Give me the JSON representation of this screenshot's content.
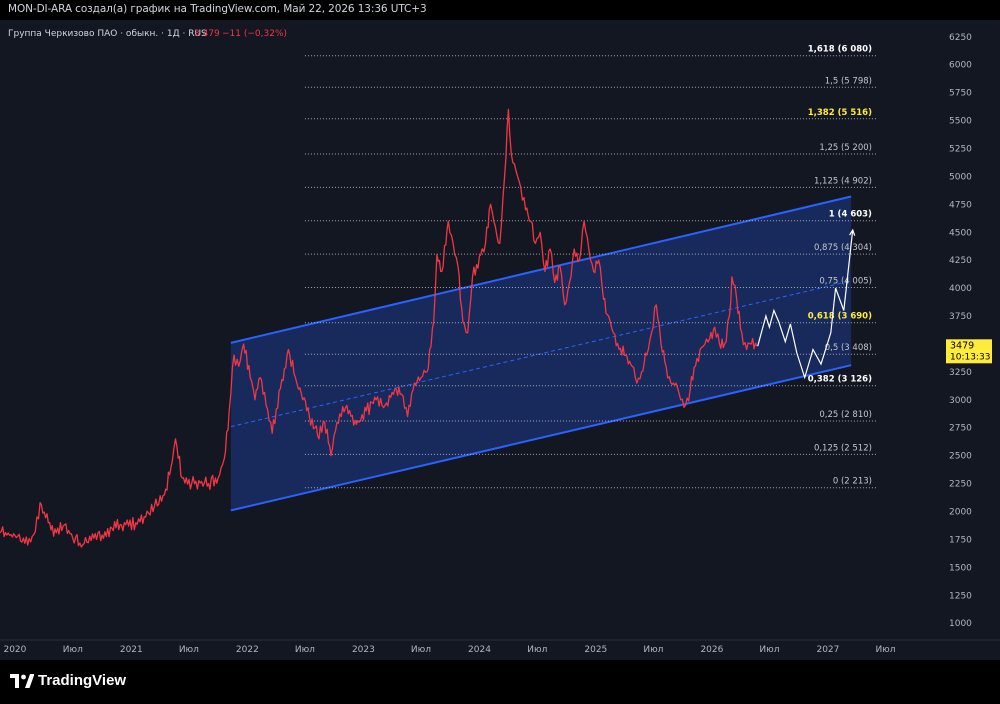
{
  "header": {
    "publish_line": "MON-DI-ARA создал(а) график на TradingView.com, Май 22, 2026 13:36 UTC+3"
  },
  "legend": {
    "symbol_line": "Группа Черкизово ПАО · обыкн. · 1Д · RUS",
    "price": "3 479",
    "change": "−11 (−0,32%)"
  },
  "price_tag": {
    "price": "3479",
    "countdown": "10:13:33"
  },
  "branding": {
    "logo_text": "TradingView"
  },
  "colors": {
    "background": "#131722",
    "panel": "#000000",
    "price_line": "#f23645",
    "channel": "#2962ff",
    "channel_fill": "#1e3a8a",
    "fib_line": "#9598a1",
    "highlight_level": "#ffeb3b",
    "projection": "#ffffff",
    "text": "#d1d4dc"
  },
  "chart_data": {
    "type": "line",
    "title": "Группа Черкизово ПАО · обыкн. · 1Д · RUS",
    "ylim": [
      850,
      6400
    ],
    "y_ticks": [
      1000,
      1250,
      1500,
      1750,
      2000,
      2250,
      2500,
      2750,
      3000,
      3250,
      3500,
      3750,
      4000,
      4250,
      4500,
      4750,
      5000,
      5250,
      5500,
      5750,
      6000,
      6250
    ],
    "xlim": [
      "2019-11-15",
      "2028-01-01"
    ],
    "x_ticks": [
      {
        "label": "2020",
        "date": "2020-01-01"
      },
      {
        "label": "Июл",
        "date": "2020-07-01"
      },
      {
        "label": "2021",
        "date": "2021-01-01"
      },
      {
        "label": "Июл",
        "date": "2021-07-01"
      },
      {
        "label": "2022",
        "date": "2022-01-01"
      },
      {
        "label": "Июл",
        "date": "2022-07-01"
      },
      {
        "label": "2023",
        "date": "2023-01-01"
      },
      {
        "label": "Июл",
        "date": "2023-07-01"
      },
      {
        "label": "2024",
        "date": "2024-01-01"
      },
      {
        "label": "Июл",
        "date": "2024-07-01"
      },
      {
        "label": "2025",
        "date": "2025-01-01"
      },
      {
        "label": "Июл",
        "date": "2025-07-01"
      },
      {
        "label": "2026",
        "date": "2026-01-01"
      },
      {
        "label": "Июл",
        "date": "2026-07-01"
      },
      {
        "label": "2027",
        "date": "2027-01-01"
      },
      {
        "label": "Июл",
        "date": "2027-07-01"
      }
    ],
    "grid": false,
    "series": [
      {
        "type": "line",
        "color": "#f23645",
        "points": [
          [
            "2019-11-15",
            1810
          ],
          [
            "2020-01-10",
            1780
          ],
          [
            "2020-02-10",
            1700
          ],
          [
            "2020-03-05",
            1820
          ],
          [
            "2020-03-20",
            2080
          ],
          [
            "2020-04-15",
            1900
          ],
          [
            "2020-05-10",
            1810
          ],
          [
            "2020-06-05",
            1880
          ],
          [
            "2020-07-01",
            1760
          ],
          [
            "2020-08-01",
            1700
          ],
          [
            "2020-09-01",
            1800
          ],
          [
            "2020-10-01",
            1790
          ],
          [
            "2020-11-01",
            1850
          ],
          [
            "2020-12-01",
            1880
          ],
          [
            "2021-01-15",
            1900
          ],
          [
            "2021-02-15",
            1950
          ],
          [
            "2021-03-15",
            2050
          ],
          [
            "2021-04-15",
            2150
          ],
          [
            "2021-05-10",
            2450
          ],
          [
            "2021-05-20",
            2650
          ],
          [
            "2021-06-10",
            2300
          ],
          [
            "2021-07-10",
            2250
          ],
          [
            "2021-08-10",
            2270
          ],
          [
            "2021-09-01",
            2250
          ],
          [
            "2021-10-01",
            2300
          ],
          [
            "2021-10-20",
            2470
          ],
          [
            "2021-11-05",
            2900
          ],
          [
            "2021-11-20",
            3400
          ],
          [
            "2021-12-05",
            3300
          ],
          [
            "2021-12-20",
            3500
          ],
          [
            "2022-01-10",
            3200
          ],
          [
            "2022-01-25",
            3000
          ],
          [
            "2022-02-10",
            3200
          ],
          [
            "2022-03-01",
            2950
          ],
          [
            "2022-03-20",
            2700
          ],
          [
            "2022-04-15",
            3100
          ],
          [
            "2022-05-10",
            3450
          ],
          [
            "2022-06-01",
            3200
          ],
          [
            "2022-06-20",
            3050
          ],
          [
            "2022-07-15",
            2850
          ],
          [
            "2022-08-10",
            2680
          ],
          [
            "2022-09-01",
            2800
          ],
          [
            "2022-09-21",
            2500
          ],
          [
            "2022-10-10",
            2800
          ],
          [
            "2022-11-10",
            2950
          ],
          [
            "2022-12-10",
            2780
          ],
          [
            "2023-01-10",
            2900
          ],
          [
            "2023-02-10",
            3000
          ],
          [
            "2023-03-10",
            2950
          ],
          [
            "2023-04-10",
            3100
          ],
          [
            "2023-05-01",
            3050
          ],
          [
            "2023-05-20",
            2850
          ],
          [
            "2023-06-10",
            3150
          ],
          [
            "2023-07-01",
            3200
          ],
          [
            "2023-07-20",
            3250
          ],
          [
            "2023-08-10",
            3700
          ],
          [
            "2023-08-20",
            4300
          ],
          [
            "2023-09-05",
            4150
          ],
          [
            "2023-09-25",
            4600
          ],
          [
            "2023-10-10",
            4400
          ],
          [
            "2023-10-25",
            4200
          ],
          [
            "2023-11-10",
            3700
          ],
          [
            "2023-11-25",
            3600
          ],
          [
            "2023-12-10",
            4100
          ],
          [
            "2024-01-05",
            4300
          ],
          [
            "2024-01-20",
            4400
          ],
          [
            "2024-02-05",
            4750
          ],
          [
            "2024-02-20",
            4550
          ],
          [
            "2024-03-05",
            4400
          ],
          [
            "2024-03-20",
            5000
          ],
          [
            "2024-04-01",
            5600
          ],
          [
            "2024-04-10",
            5200
          ],
          [
            "2024-04-25",
            5050
          ],
          [
            "2024-05-10",
            4900
          ],
          [
            "2024-05-25",
            4700
          ],
          [
            "2024-06-10",
            4600
          ],
          [
            "2024-06-25",
            4400
          ],
          [
            "2024-07-10",
            4500
          ],
          [
            "2024-07-25",
            4150
          ],
          [
            "2024-08-10",
            4350
          ],
          [
            "2024-08-25",
            4050
          ],
          [
            "2024-09-10",
            4200
          ],
          [
            "2024-09-25",
            3850
          ],
          [
            "2024-10-10",
            4050
          ],
          [
            "2024-10-25",
            4350
          ],
          [
            "2024-11-10",
            4250
          ],
          [
            "2024-11-25",
            4600
          ],
          [
            "2024-12-10",
            4350
          ],
          [
            "2024-12-25",
            4150
          ],
          [
            "2025-01-10",
            4250
          ],
          [
            "2025-01-25",
            3900
          ],
          [
            "2025-02-10",
            3750
          ],
          [
            "2025-02-25",
            3600
          ],
          [
            "2025-03-15",
            3450
          ],
          [
            "2025-04-05",
            3400
          ],
          [
            "2025-04-25",
            3300
          ],
          [
            "2025-05-10",
            3150
          ],
          [
            "2025-05-25",
            3250
          ],
          [
            "2025-06-10",
            3400
          ],
          [
            "2025-06-25",
            3600
          ],
          [
            "2025-07-10",
            3850
          ],
          [
            "2025-07-25",
            3500
          ],
          [
            "2025-08-10",
            3300
          ],
          [
            "2025-08-25",
            3150
          ],
          [
            "2025-09-10",
            3150
          ],
          [
            "2025-09-25",
            3000
          ],
          [
            "2025-10-10",
            2950
          ],
          [
            "2025-10-25",
            3100
          ],
          [
            "2025-11-10",
            3300
          ],
          [
            "2025-11-25",
            3450
          ],
          [
            "2025-12-10",
            3500
          ],
          [
            "2025-12-25",
            3550
          ],
          [
            "2026-01-10",
            3650
          ],
          [
            "2026-01-25",
            3500
          ],
          [
            "2026-02-10",
            3500
          ],
          [
            "2026-02-25",
            3750
          ],
          [
            "2026-03-05",
            4100
          ],
          [
            "2026-03-20",
            3900
          ],
          [
            "2026-04-05",
            3600
          ],
          [
            "2026-04-20",
            3450
          ],
          [
            "2026-05-05",
            3500
          ],
          [
            "2026-05-22",
            3479
          ]
        ]
      },
      {
        "type": "projection",
        "color": "#ffffff",
        "points": [
          [
            "2026-05-25",
            3480
          ],
          [
            "2026-06-20",
            3750
          ],
          [
            "2026-07-01",
            3650
          ],
          [
            "2026-07-15",
            3800
          ],
          [
            "2026-07-30",
            3700
          ],
          [
            "2026-08-20",
            3520
          ],
          [
            "2026-09-05",
            3680
          ],
          [
            "2026-09-25",
            3420
          ],
          [
            "2026-10-20",
            3200
          ],
          [
            "2026-11-15",
            3450
          ],
          [
            "2026-12-10",
            3320
          ],
          [
            "2027-01-10",
            3600
          ],
          [
            "2027-01-25",
            4000
          ],
          [
            "2027-02-20",
            3800
          ],
          [
            "2027-03-20",
            4520
          ]
        ]
      }
    ],
    "channel": {
      "upper": [
        [
          "2021-11-10",
          3510
        ],
        [
          "2027-03-15",
          4820
        ]
      ],
      "lower": [
        [
          "2021-11-10",
          2010
        ],
        [
          "2027-03-15",
          3310
        ]
      ],
      "mid": [
        [
          "2021-11-10",
          2760
        ],
        [
          "2027-03-15",
          4065
        ]
      ]
    },
    "fib_levels": [
      {
        "ratio": "1,618",
        "price": 6080,
        "label": "1,618 (6 080)",
        "highlight": false,
        "bold": true
      },
      {
        "ratio": "1,5",
        "price": 5798,
        "label": "1,5 (5 798)",
        "highlight": false,
        "bold": false
      },
      {
        "ratio": "1,382",
        "price": 5516,
        "label": "1,382 (5 516)",
        "highlight": true,
        "bold": true
      },
      {
        "ratio": "1,25",
        "price": 5200,
        "label": "1,25 (5 200)",
        "highlight": false,
        "bold": false
      },
      {
        "ratio": "1,125",
        "price": 4902,
        "label": "1,125 (4 902)",
        "highlight": false,
        "bold": false
      },
      {
        "ratio": "1",
        "price": 4603,
        "label": "1 (4 603)",
        "highlight": false,
        "bold": true
      },
      {
        "ratio": "0,875",
        "price": 4304,
        "label": "0,875 (4 304)",
        "highlight": false,
        "bold": false
      },
      {
        "ratio": "0,75",
        "price": 4005,
        "label": "0,75 (4 005)",
        "highlight": false,
        "bold": false
      },
      {
        "ratio": "0,618",
        "price": 3690,
        "label": "0,618 (3 690)",
        "highlight": true,
        "bold": true
      },
      {
        "ratio": "0,5",
        "price": 3408,
        "label": "0,5 (3 408)",
        "highlight": false,
        "bold": false
      },
      {
        "ratio": "0,382",
        "price": 3126,
        "label": "0,382 (3 126)",
        "highlight": false,
        "bold": true
      },
      {
        "ratio": "0,25",
        "price": 2810,
        "label": "0,25 (2 810)",
        "highlight": false,
        "bold": false
      },
      {
        "ratio": "0,125",
        "price": 2512,
        "label": "0,125 (2 512)",
        "highlight": false,
        "bold": false
      },
      {
        "ratio": "0",
        "price": 2213,
        "label": "0 (2 213)",
        "highlight": false,
        "bold": false
      }
    ],
    "fib_start": "2022-07-01",
    "fib_end": "2027-06-01",
    "last_price": 3479
  }
}
